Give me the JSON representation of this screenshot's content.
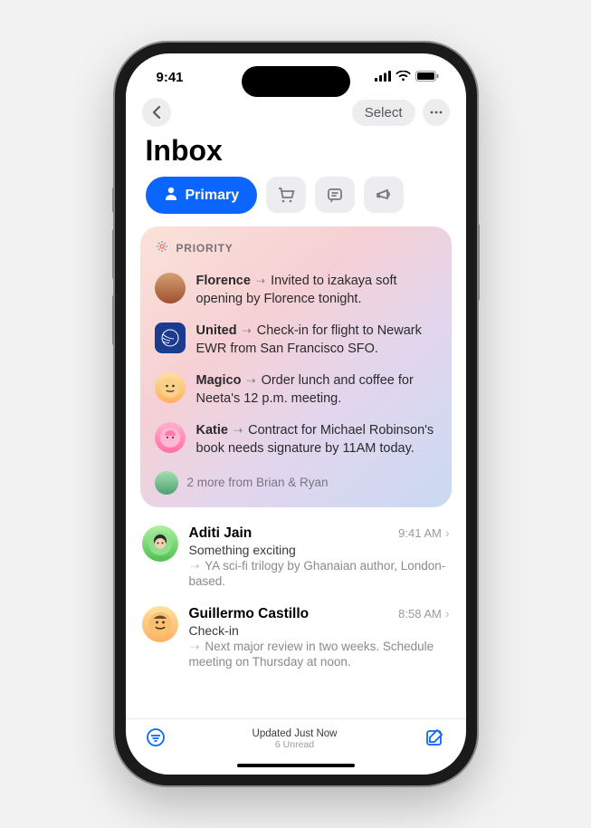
{
  "status": {
    "time": "9:41"
  },
  "nav": {
    "select_label": "Select"
  },
  "title": "Inbox",
  "categories": {
    "primary_label": "Primary"
  },
  "priority": {
    "header": "PRIORITY",
    "items": [
      {
        "sender": "Florence",
        "summary": "Invited to izakaya soft opening by Florence tonight."
      },
      {
        "sender": "United",
        "summary": "Check-in for flight to Newark EWR from San Francisco SFO."
      },
      {
        "sender": "Magico",
        "summary": "Order lunch and coffee for Neeta's 12 p.m. meeting."
      },
      {
        "sender": "Katie",
        "summary": "Contract for Michael Robinson's book needs signature by 11AM today."
      }
    ],
    "more_text": "2 more from Brian & Ryan"
  },
  "messages": [
    {
      "sender": "Aditi Jain",
      "time": "9:41 AM",
      "subject": "Something exciting",
      "preview": "YA sci-fi trilogy by Ghanaian author, London-based."
    },
    {
      "sender": "Guillermo Castillo",
      "time": "8:58 AM",
      "subject": "Check-in",
      "preview": "Next major review in two weeks. Schedule meeting on Thursday at noon."
    }
  ],
  "bottom": {
    "status": "Updated Just Now",
    "unread": "6 Unread"
  }
}
